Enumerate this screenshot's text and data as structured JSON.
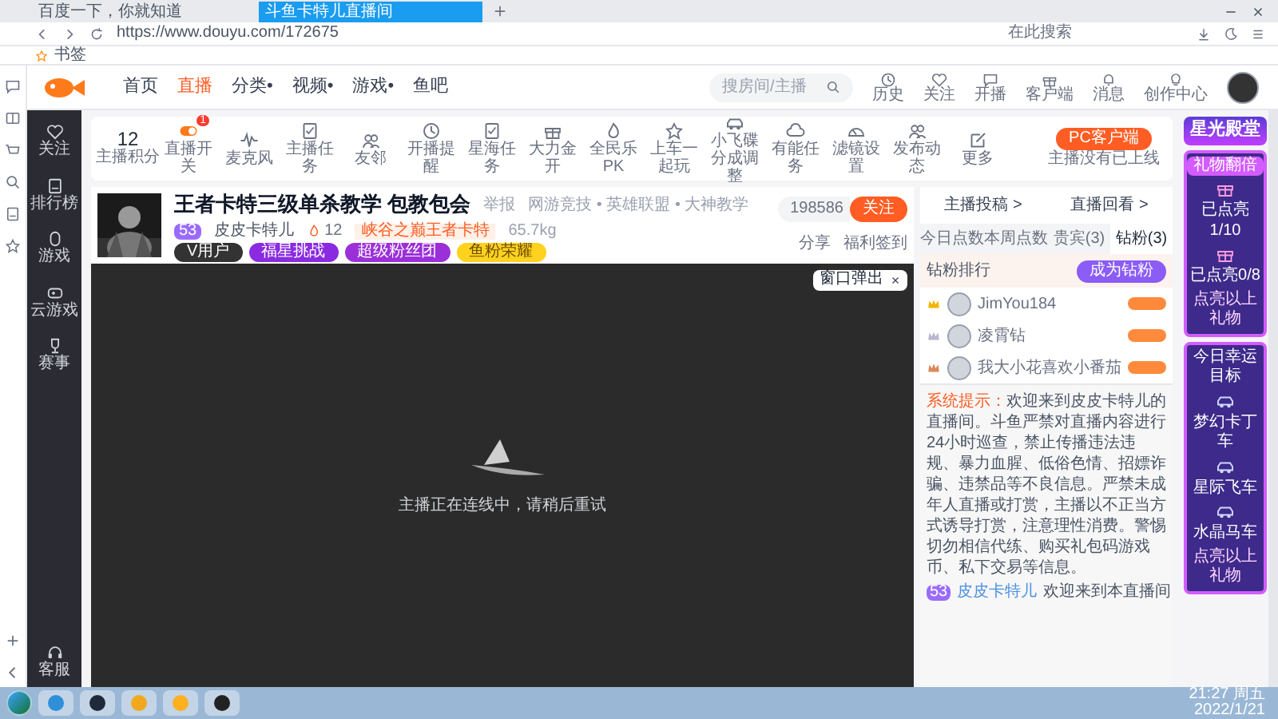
{
  "browser": {
    "tabs": [
      {
        "label": "百度一下，你就知道",
        "selected": false
      },
      {
        "label": "斗鱼卡特儿直播间",
        "selected": true
      }
    ],
    "url": "https://www.douyu.com/172675",
    "search_placeholder": "在此搜索",
    "bookmarks": [
      "书签"
    ]
  },
  "nav": {
    "links": [
      {
        "label": "首页",
        "selected": false
      },
      {
        "label": "直播",
        "selected": true
      },
      {
        "label": "分类•",
        "selected": false
      },
      {
        "label": "视频•",
        "selected": false
      },
      {
        "label": "游戏•",
        "selected": false
      },
      {
        "label": "鱼吧",
        "selected": false
      }
    ],
    "search_placeholder": "搜房间/主播",
    "actions": [
      "历史",
      "关注",
      "开播",
      "客户端",
      "消息",
      "创作中心"
    ]
  },
  "sidebar": {
    "items": [
      "关注",
      "排行榜",
      "游戏",
      "云游戏",
      "赛事"
    ],
    "footer": "客服"
  },
  "toolbar": {
    "score": "12",
    "score_label": "主播积分",
    "badge": "1",
    "items": [
      "直播开关",
      "麦克风",
      "主播任务",
      "友邻",
      "开播提醒",
      "星海任务",
      "大力金开",
      "全民乐PK",
      "上车一起玩",
      "小飞碟分成调整",
      "有能任务",
      "滤镜设置",
      "发布动态",
      "更多"
    ],
    "client_button": "PC客户端",
    "client_note": "主播没有已上线"
  },
  "room": {
    "title": "王者卡特三级单杀教学 包教包会",
    "report": "举报",
    "category": "网游竞技 • 英雄联盟 • 大神教学",
    "level": "53",
    "anchor": "皮皮卡特儿",
    "hot": "12",
    "honor": "峡谷之巅王者卡特",
    "weight": "65.7kg",
    "badges": [
      "V用户",
      "福星挑战",
      "超级粉丝团",
      "鱼粉荣耀"
    ],
    "followers": "198586",
    "follow": "关注",
    "share": "分享",
    "sign": "福利签到"
  },
  "video": {
    "popout": "窗口弹出",
    "message": "主播正在连线中，请稍后重试"
  },
  "panel": {
    "links": [
      "主播投稿 >",
      "直播回看 >"
    ],
    "tabs": [
      {
        "label": "今日点数",
        "selected": false
      },
      {
        "label": "本周点数",
        "selected": false
      },
      {
        "label": "贵宾(3)",
        "selected": false
      },
      {
        "label": "钻粉(3)",
        "selected": true
      }
    ],
    "rank_title": "钻粉排行",
    "join": "成为钻粉",
    "fans": [
      {
        "name": "JimYou184",
        "color": "#f5b400"
      },
      {
        "name": "凌霄钻",
        "color": "#b8b8d0"
      },
      {
        "name": "我大小花喜欢小番茄",
        "color": "#d9895a"
      }
    ],
    "notice_label": "系统提示：",
    "notice": "欢迎来到皮皮卡特儿的直播间。斗鱼严禁对直播内容进行24小时巡查，禁止传播违法违规、暴力血腥、低俗色情、招嫖诈骗、违禁品等不良信息。严禁未成年人直播或打赏，主播以不正当方式诱导打赏，注意理性消费。警惕切勿相信代练、购买礼包码游戏币、私下交易等信息。",
    "welcome": {
      "level": "53",
      "user": "皮皮卡特儿",
      "text": "欢迎来到本直播间"
    }
  },
  "promo": {
    "title": "星光殿堂",
    "section": "礼物翻倍",
    "progress": [
      {
        "label": "已点亮",
        "count": "1/10"
      },
      {
        "label": "已点亮",
        "count": "0/8"
      }
    ],
    "note": "点亮以上礼物",
    "target": "今日幸运目标",
    "cars": [
      "梦幻卡丁车",
      "星际飞车",
      "水晶马车"
    ],
    "footer": "点亮以上礼物"
  },
  "taskbar": {
    "time": "21:27 周五",
    "date": "2022/1/21"
  }
}
